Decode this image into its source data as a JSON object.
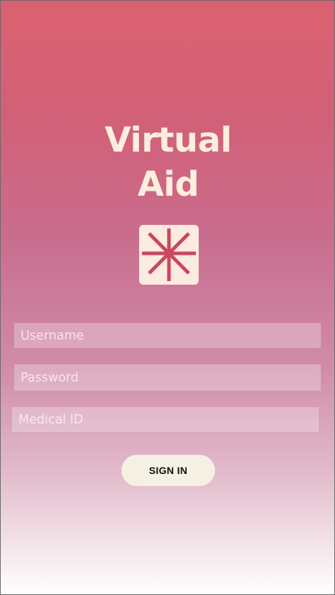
{
  "app": {
    "title_line1": "Virtual",
    "title_line2": "Aid",
    "logo_icon": "asterisk-icon"
  },
  "form": {
    "username_placeholder": "Username",
    "password_placeholder": "Password",
    "medical_id_placeholder": "Medical ID",
    "username_value": "",
    "password_value": "",
    "medical_id_value": "",
    "sign_in_label": "SIGN IN"
  },
  "colors": {
    "gradient_top": "#dc6170",
    "gradient_bottom": "#ffffff",
    "title_color": "#fdeede",
    "logo_tile": "#fcebe0",
    "logo_mark": "#c9485f",
    "button_bg": "#f4f1e4"
  }
}
